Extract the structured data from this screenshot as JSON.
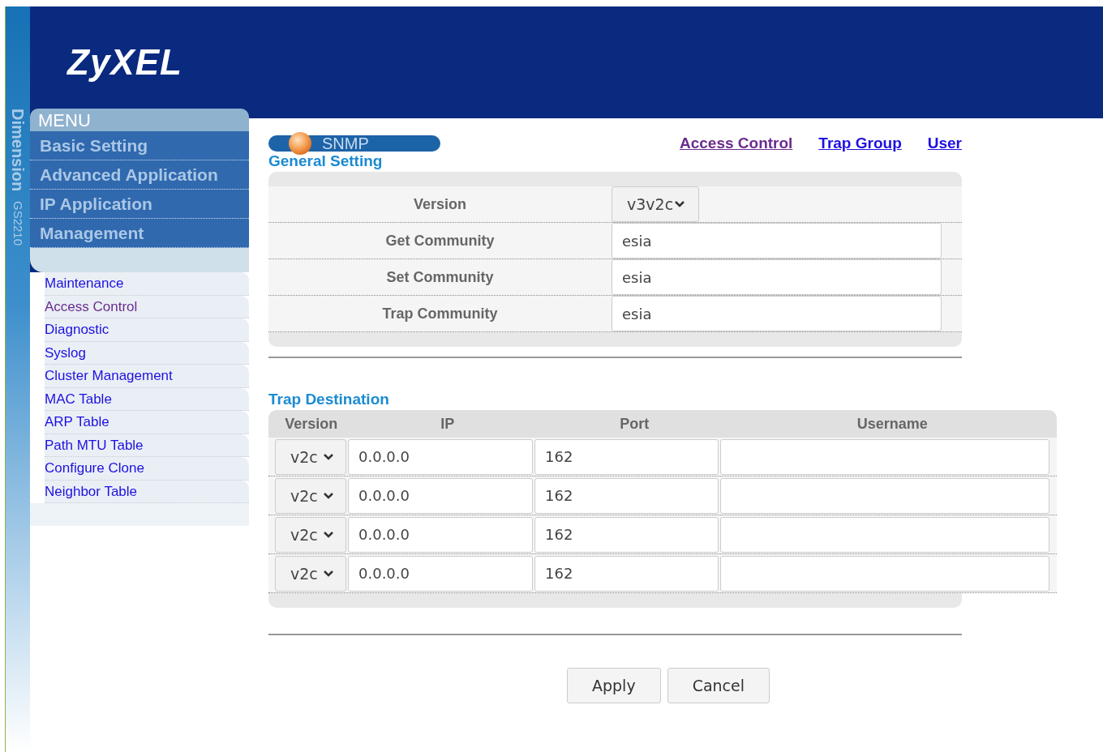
{
  "brand": {
    "logo": "ZyXEL",
    "series": "Dimension",
    "model": "GS2210"
  },
  "menu": {
    "title": "MENU",
    "sections": [
      {
        "label": "Basic Setting"
      },
      {
        "label": "Advanced Application"
      },
      {
        "label": "IP Application"
      },
      {
        "label": "Management"
      }
    ],
    "items": [
      {
        "label": "Maintenance",
        "visited": false
      },
      {
        "label": "Access Control",
        "visited": true
      },
      {
        "label": "Diagnostic",
        "visited": false
      },
      {
        "label": "Syslog",
        "visited": false
      },
      {
        "label": "Cluster Management",
        "visited": false
      },
      {
        "label": "MAC Table",
        "visited": false
      },
      {
        "label": "ARP Table",
        "visited": false
      },
      {
        "label": "Path MTU Table",
        "visited": false
      },
      {
        "label": "Configure Clone",
        "visited": false
      },
      {
        "label": "Neighbor Table",
        "visited": false
      }
    ]
  },
  "page": {
    "title": "SNMP",
    "links": [
      {
        "label": "Access Control",
        "visited": true
      },
      {
        "label": "Trap Group",
        "visited": false
      },
      {
        "label": "User",
        "visited": false
      }
    ]
  },
  "general_setting": {
    "title": "General Setting",
    "rows": [
      {
        "kind": "select",
        "label": "Version",
        "value": "v3v2c"
      },
      {
        "kind": "text",
        "label": "Get Community",
        "value": "esia"
      },
      {
        "kind": "text",
        "label": "Set Community",
        "value": "esia"
      },
      {
        "kind": "text",
        "label": "Trap Community",
        "value": "esia"
      }
    ]
  },
  "trap_destination": {
    "title": "Trap Destination",
    "columns": [
      "Version",
      "IP",
      "Port",
      "Username"
    ],
    "rows": [
      {
        "version": "v2c",
        "ip": "0.0.0.0",
        "port": "162"
      },
      {
        "version": "v2c",
        "ip": "0.0.0.0",
        "port": "162"
      },
      {
        "version": "v2c",
        "ip": "0.0.0.0",
        "port": "162"
      },
      {
        "version": "v2c",
        "ip": "0.0.0.0",
        "port": "162"
      }
    ]
  },
  "buttons": [
    "Apply",
    "Cancel"
  ]
}
